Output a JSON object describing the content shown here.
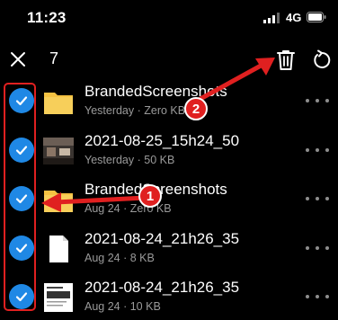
{
  "status_bar": {
    "time": "11:23",
    "network": "4G"
  },
  "toolbar": {
    "selected_count": "7"
  },
  "files": [
    {
      "name": "BrandedScreenshots",
      "meta": "Yesterday · Zero KB",
      "type": "folder",
      "selected": true
    },
    {
      "name": "2021-08-25_15h24_50",
      "meta": "Yesterday · 50 KB",
      "type": "photo",
      "selected": true
    },
    {
      "name": "BrandedScreenshots",
      "meta": "Aug 24 · Zero KB",
      "type": "folder",
      "selected": true
    },
    {
      "name": "2021-08-24_21h26_35",
      "meta": "Aug 24 · 8 KB",
      "type": "document",
      "selected": true
    },
    {
      "name": "2021-08-24_21h26_35",
      "meta": "Aug 24 · 10 KB",
      "type": "screenshot",
      "selected": true
    }
  ],
  "annotations": {
    "badge_1": "1",
    "badge_2": "2",
    "color": "#e02020"
  },
  "colors": {
    "accent": "#1f88e5",
    "folder": "#f5c242",
    "background": "#000000"
  }
}
